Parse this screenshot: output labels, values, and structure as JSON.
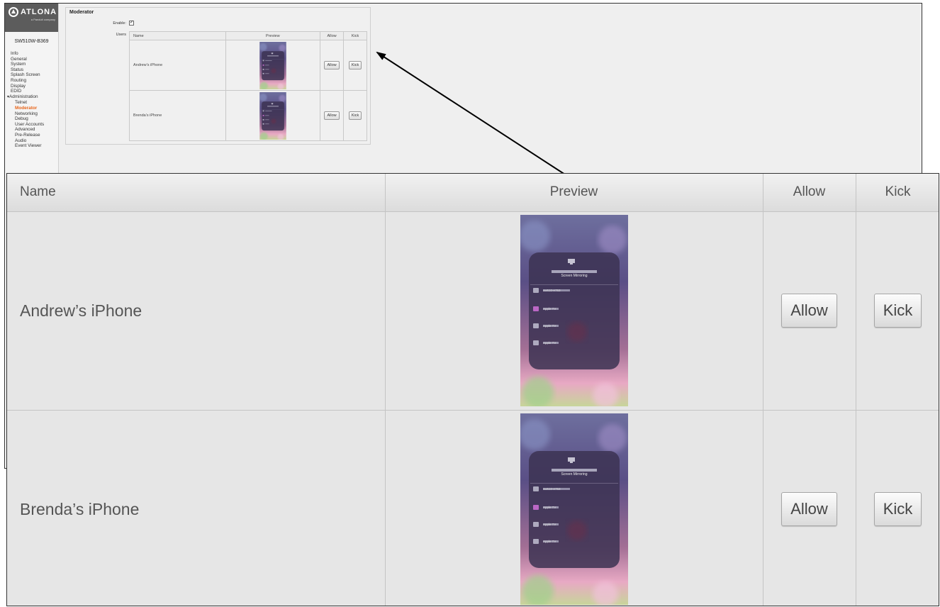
{
  "sidebar": {
    "logo_text": "ATLONA",
    "logo_sub": "a Panduit company",
    "device_name": "SW510W-B369",
    "items": [
      {
        "label": "Info"
      },
      {
        "label": "General"
      },
      {
        "label": "System"
      },
      {
        "label": "Status"
      },
      {
        "label": "Splash Screen"
      },
      {
        "label": "Routing"
      },
      {
        "label": "Display"
      },
      {
        "label": "EDID"
      },
      {
        "label": "Administration"
      },
      {
        "label": "Telnet"
      },
      {
        "label": "Moderator"
      },
      {
        "label": "Networking"
      },
      {
        "label": "Debug"
      },
      {
        "label": "User Accounts"
      },
      {
        "label": "Advanced"
      },
      {
        "label": "Pre-Release"
      },
      {
        "label": "Audio"
      },
      {
        "label": "Event Viewer"
      }
    ],
    "active_item": "Moderator"
  },
  "moderator": {
    "title": "Moderator",
    "enable_label": "Enable:",
    "enable_checked": true,
    "users_label": "Users"
  },
  "table": {
    "headers": {
      "name": "Name",
      "preview": "Preview",
      "allow": "Allow",
      "kick": "Kick"
    },
    "rows": [
      {
        "name": "Andrew’s iPhone",
        "allow_label": "Allow",
        "kick_label": "Kick"
      },
      {
        "name": "Brenda’s iPhone",
        "allow_label": "Allow",
        "kick_label": "Kick"
      }
    ]
  },
  "preview": {
    "title": "Screen Mirroring",
    "devices": [
      "sw510-e753",
      "Apple TV",
      "Apple TV",
      "Apple TV"
    ]
  },
  "colors": {
    "accent": "#e8651a",
    "logo_bar": "#5c5c5c"
  },
  "icons": {
    "check": "✓"
  }
}
